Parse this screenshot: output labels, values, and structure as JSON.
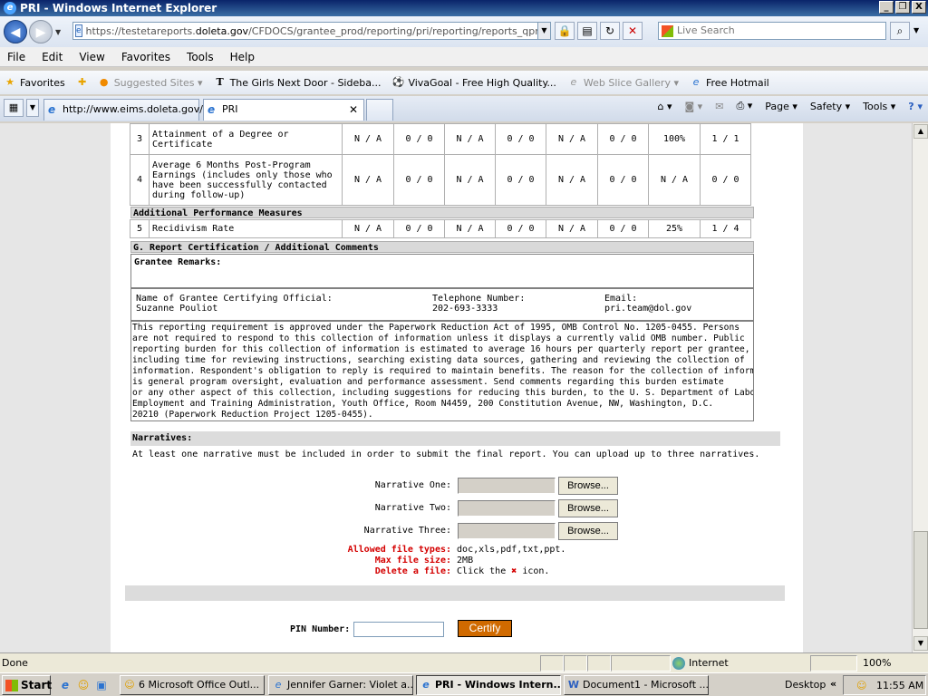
{
  "window": {
    "title": "PRI - Windows Internet Explorer",
    "buttons": [
      "_",
      "❐",
      "X"
    ]
  },
  "address_bar": {
    "url_prefix": "https://testetareports.",
    "url_domain": "doleta.gov",
    "url_path": "/CFDOCS/grantee_prod/reporting/pri/reporting/reports_qpr_new.c",
    "search_placeholder": "Live Search"
  },
  "menu": [
    "File",
    "Edit",
    "View",
    "Favorites",
    "Tools",
    "Help"
  ],
  "favorites_bar": {
    "favorites_label": "Favorites",
    "items": [
      {
        "label": "Suggested Sites ▾",
        "icon": "suggested-sites-icon",
        "dim": true
      },
      {
        "label": "The Girls Next Door - Sideba...",
        "icon": "nyt-icon",
        "dim": false
      },
      {
        "label": "VivaGoal - Free High Quality...",
        "icon": "soccer-ball-icon",
        "dim": false
      },
      {
        "label": "Web Slice Gallery ▾",
        "icon": "ie-icon",
        "dim": true
      },
      {
        "label": "Free Hotmail",
        "icon": "ie-icon",
        "dim": false
      }
    ]
  },
  "tabs": [
    {
      "label": "http://www.eims.doleta.gov/",
      "active": false
    },
    {
      "label": "PRI",
      "active": true
    }
  ],
  "command_bar": [
    "Page ▾",
    "Safety ▾",
    "Tools ▾"
  ],
  "performance_rows": [
    {
      "num": "3",
      "label": "Attainment of a Degree or Certificate",
      "cells": [
        "N / A",
        "0 / 0",
        "N / A",
        "0 / 0",
        "N / A",
        "0 / 0",
        "100%",
        "1 / 1"
      ]
    },
    {
      "num": "4",
      "label": "Average 6 Months Post-Program Earnings (includes only those who have been successfully contacted during follow-up)",
      "cells": [
        "N / A",
        "0 / 0",
        "N / A",
        "0 / 0",
        "N / A",
        "0 / 0",
        "N / A",
        "0 / 0"
      ]
    }
  ],
  "additional_measures_heading": "Additional Performance Measures",
  "recidivism_row": {
    "num": "5",
    "label": "Recidivism Rate",
    "cells": [
      "N / A",
      "0 / 0",
      "N / A",
      "0 / 0",
      "N / A",
      "0 / 0",
      "25%",
      "1 / 4"
    ]
  },
  "section_g_heading": "G. Report Certification / Additional Comments",
  "grantee_remarks_label": "Grantee Remarks:",
  "certifying": {
    "name_label": "Name of Grantee Certifying Official:",
    "name_value": "Suzanne Pouliot",
    "phone_label": "Telephone Number:",
    "phone_value": "202-693-3333",
    "email_label": "Email:",
    "email_value": "pri.team@dol.gov"
  },
  "paperwork_lines": [
    "This reporting requirement is approved under the Paperwork Reduction Act of 1995, OMB Control No. 1205-0455. Persons",
    "are not required to respond to this collection of information unless it displays a currently valid OMB number. Public",
    "reporting burden for this collection of information is estimated to average 16 hours per quarterly report per grantee,",
    "including time for reviewing instructions, searching existing data sources, gathering and reviewing the collection of",
    "information. Respondent's obligation to reply is required to maintain benefits. The reason for the collection of information",
    "is general program oversight, evaluation and performance assessment. Send comments regarding this burden estimate",
    "or any other aspect of this collection, including suggestions for reducing this burden, to the U. S. Department of Labor,",
    "Employment and Training Administration, Youth Office, Room N4459, 200 Constitution Avenue, NW, Washington, D.C.",
    "20210 (Paperwork Reduction Project 1205-0455)."
  ],
  "narratives": {
    "heading": "Narratives:",
    "note": "At least one narrative must be included in order to submit the final report. You can upload up to three narratives.",
    "fields": [
      {
        "label": "Narrative One:",
        "button": "Browse..."
      },
      {
        "label": "Narrative Two:",
        "button": "Browse..."
      },
      {
        "label": "Narrative Three:",
        "button": "Browse..."
      }
    ],
    "info": [
      {
        "key": "Allowed file types:",
        "value": "doc,xls,pdf,txt,ppt."
      },
      {
        "key": "Max file size:",
        "value": "2MB"
      },
      {
        "key": "Delete a file:",
        "value_pre": "Click the",
        "value_x": "✖",
        "value_post": "icon."
      }
    ]
  },
  "pin": {
    "label": "PIN Number:",
    "value": ""
  },
  "certify_button": "Certify",
  "status": {
    "text": "Done",
    "zone": "Internet",
    "zoom": "100%"
  },
  "taskbar": {
    "start": "Start",
    "tasks": [
      {
        "label": "6 Microsoft Office Outl...",
        "active": false
      },
      {
        "label": "Jennifer Garner: Violet a...",
        "active": false
      },
      {
        "label": "PRI - Windows Intern...",
        "active": true
      },
      {
        "label": "Document1 - Microsoft ...",
        "active": false
      }
    ],
    "desktop": "Desktop",
    "clock": "11:55 AM"
  }
}
